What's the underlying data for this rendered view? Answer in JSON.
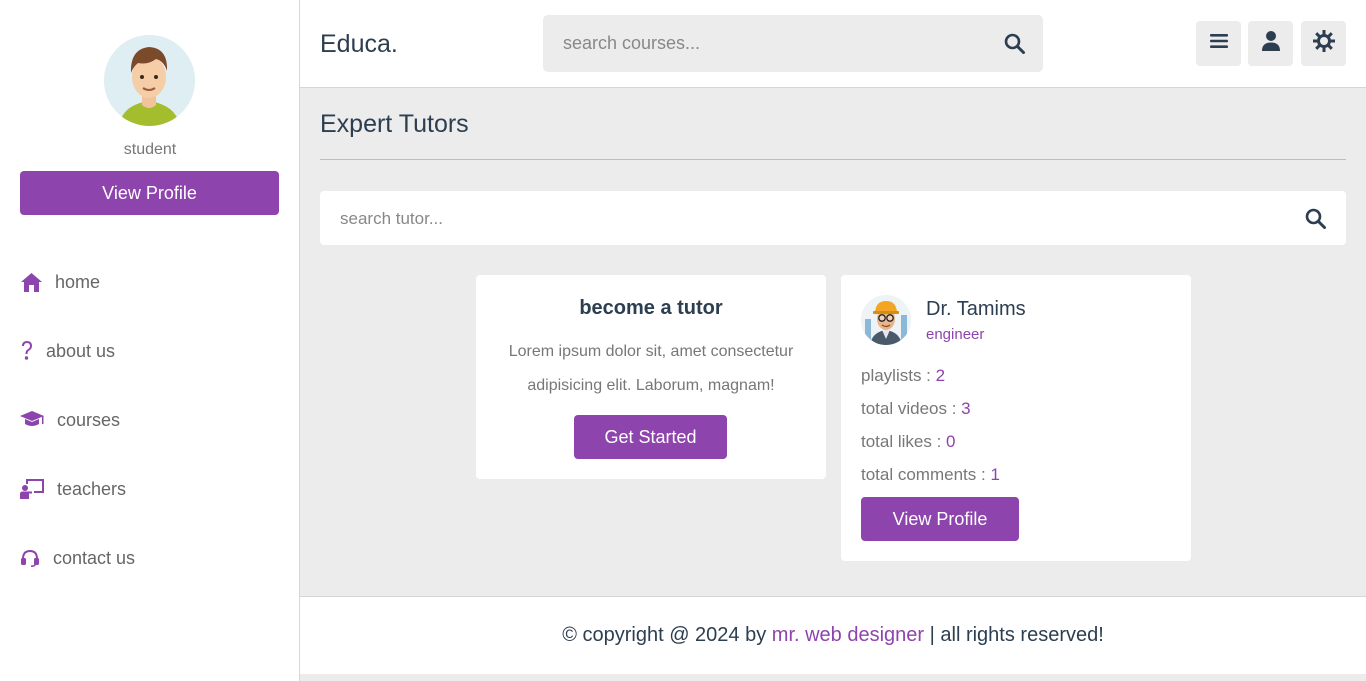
{
  "sidebar": {
    "role": "student",
    "profile_button": "View Profile",
    "items": [
      {
        "label": "home",
        "icon": "home-icon"
      },
      {
        "label": "about us",
        "icon": "question-icon"
      },
      {
        "label": "courses",
        "icon": "graduation-cap-icon"
      },
      {
        "label": "teachers",
        "icon": "chalkboard-teacher-icon"
      },
      {
        "label": "contact us",
        "icon": "headset-icon"
      }
    ]
  },
  "header": {
    "logo": "Educa.",
    "search_placeholder": "search courses...",
    "buttons": [
      "menu-icon",
      "user-icon",
      "theme-toggle-icon"
    ]
  },
  "main": {
    "title": "Expert Tutors",
    "search_placeholder": "search tutor...",
    "become_card": {
      "title": "become a tutor",
      "description": "Lorem ipsum dolor sit, amet consectetur adipisicing elit. Laborum, magnam!",
      "button": "Get Started"
    },
    "tutor": {
      "name": "Dr. Tamims",
      "profession": "engineer",
      "stats": [
        {
          "label": "playlists : ",
          "value": "2"
        },
        {
          "label": "total videos : ",
          "value": "3"
        },
        {
          "label": "total likes : ",
          "value": "0"
        },
        {
          "label": "total comments : ",
          "value": "1"
        }
      ],
      "button": "View Profile"
    }
  },
  "footer": {
    "prefix": "© copyright @ 2024 by ",
    "link": "mr. web designer",
    "suffix": " | all rights reserved!"
  },
  "colors": {
    "accent": "#8e44ad",
    "text": "#2c3e50",
    "background": "#ececec"
  }
}
